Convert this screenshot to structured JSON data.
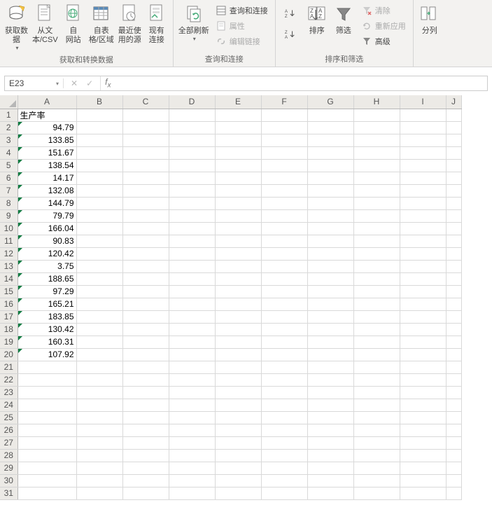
{
  "ribbon": {
    "groups": {
      "data_source": {
        "label": "获取和转换数据",
        "get_data": "获取数\n据",
        "from_csv": "从文\n本/CSV",
        "from_web": "自\n网站",
        "from_table": "自表\n格/区域",
        "recent": "最近使\n用的源",
        "existing": "现有\n连接"
      },
      "queries": {
        "label": "查询和连接",
        "refresh_all": "全部刷新",
        "queries_conn": "查询和连接",
        "properties": "属性",
        "edit_links": "编辑链接"
      },
      "sort_filter": {
        "label": "排序和筛选",
        "sort": "排序",
        "filter": "筛选",
        "clear": "清除",
        "reapply": "重新应用",
        "advanced": "高级"
      },
      "tools": {
        "text_to_cols": "分列"
      }
    }
  },
  "namebox": {
    "value": "E23"
  },
  "formula": {
    "value": ""
  },
  "sheet": {
    "columns": [
      "A",
      "B",
      "C",
      "D",
      "E",
      "F",
      "G",
      "H",
      "I",
      "J"
    ],
    "header": "生产率",
    "values": [
      "94.79",
      "133.85",
      "151.67",
      "138.54",
      "14.17",
      "132.08",
      "144.79",
      "79.79",
      "166.04",
      "90.83",
      "120.42",
      "3.75",
      "188.65",
      "97.29",
      "165.21",
      "183.85",
      "130.42",
      "160.31",
      "107.92"
    ],
    "total_rows": 31
  },
  "chart_data": {
    "type": "table",
    "title": "生产率",
    "categories": [
      "row2",
      "row3",
      "row4",
      "row5",
      "row6",
      "row7",
      "row8",
      "row9",
      "row10",
      "row11",
      "row12",
      "row13",
      "row14",
      "row15",
      "row16",
      "row17",
      "row18",
      "row19",
      "row20"
    ],
    "values": [
      94.79,
      133.85,
      151.67,
      138.54,
      14.17,
      132.08,
      144.79,
      79.79,
      166.04,
      90.83,
      120.42,
      3.75,
      188.65,
      97.29,
      165.21,
      183.85,
      130.42,
      160.31,
      107.92
    ]
  }
}
